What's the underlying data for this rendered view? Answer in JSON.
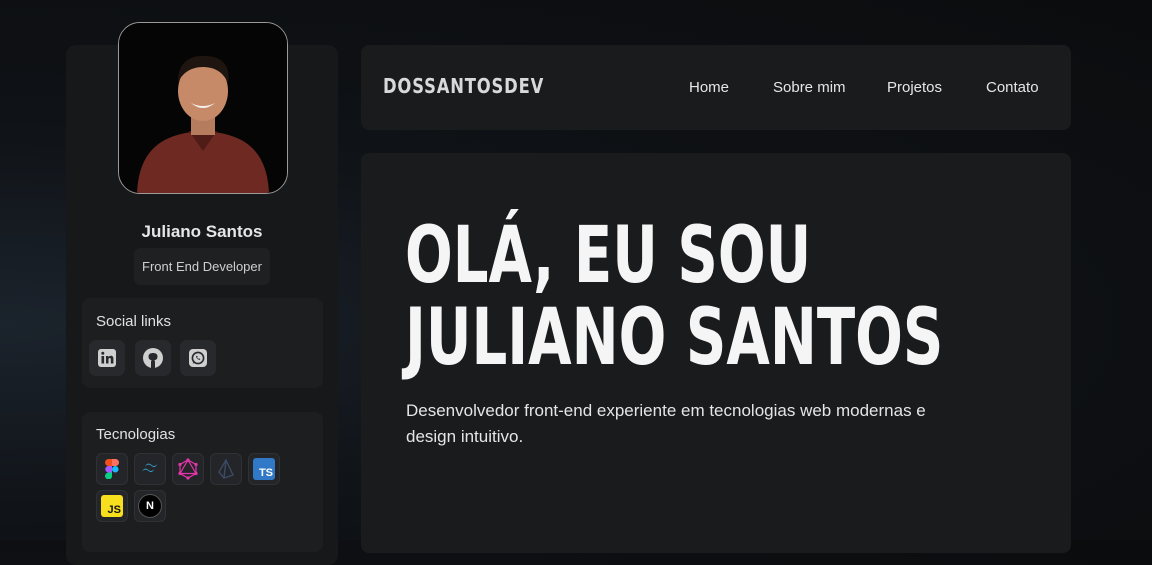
{
  "profile": {
    "name": "Juliano Santos",
    "role": "Front End Developer"
  },
  "social": {
    "title": "Social links",
    "links": [
      {
        "icon": "linkedin-icon"
      },
      {
        "icon": "github-icon"
      },
      {
        "icon": "whatsapp-icon"
      }
    ]
  },
  "tech": {
    "title": "Tecnologias",
    "items": [
      {
        "icon": "figma-icon"
      },
      {
        "icon": "tailwind-icon"
      },
      {
        "icon": "graphql-icon"
      },
      {
        "icon": "prisma-icon"
      },
      {
        "icon": "typescript-icon",
        "label": "TS"
      },
      {
        "icon": "javascript-icon",
        "label": "JS"
      },
      {
        "icon": "nextjs-icon",
        "label": "N"
      }
    ]
  },
  "nav": {
    "brand": "DOSSANTOSDEV",
    "links": [
      "Home",
      "Sobre mim",
      "Projetos",
      "Contato"
    ]
  },
  "hero": {
    "line1": "OLÁ, EU SOU",
    "line2": "JULIANO SANTOS",
    "subtitle": "Desenvolvedor front-end experiente em tecnologias web modernas e design intuitivo."
  },
  "colors": {
    "background": "#0d0f12",
    "panel": "#1a1b1d",
    "card": "#1d1e20",
    "typescript": "#3178c6",
    "javascript": "#f7df1e",
    "graphql": "#e535ab",
    "tailwind": "#38bdf8"
  }
}
